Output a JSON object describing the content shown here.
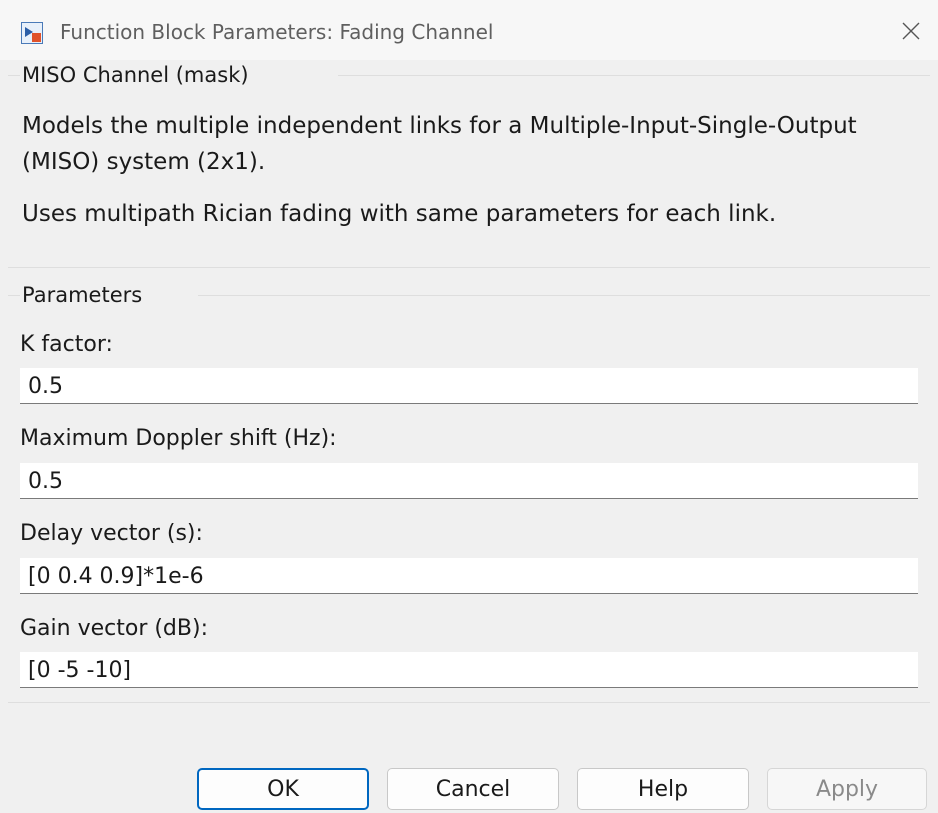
{
  "window": {
    "title": "Function Block Parameters: Fading Channel",
    "icon": "simulink-block-icon",
    "close_icon": "close-icon"
  },
  "mask_group": {
    "title": "MISO Channel (mask)",
    "description_1": "Models the multiple independent links for a Multiple-Input-Single-Output (MISO) system (2x1).",
    "description_2": "Uses multipath Rician fading with same parameters for each link."
  },
  "parameters_group": {
    "title": "Parameters",
    "fields": [
      {
        "label": "K factor:",
        "value": "0.5"
      },
      {
        "label": "Maximum Doppler shift (Hz):",
        "value": "0.5"
      },
      {
        "label": "Delay vector (s):",
        "value": "[0 0.4 0.9]*1e-6"
      },
      {
        "label": "Gain vector (dB):",
        "value": "[0 -5 -10]"
      }
    ]
  },
  "buttons": {
    "ok": "OK",
    "cancel": "Cancel",
    "help": "Help",
    "apply": "Apply"
  },
  "colors": {
    "accent": "#0067c0",
    "background": "#f0f0f0",
    "disabled_text": "#8a8a8a"
  }
}
